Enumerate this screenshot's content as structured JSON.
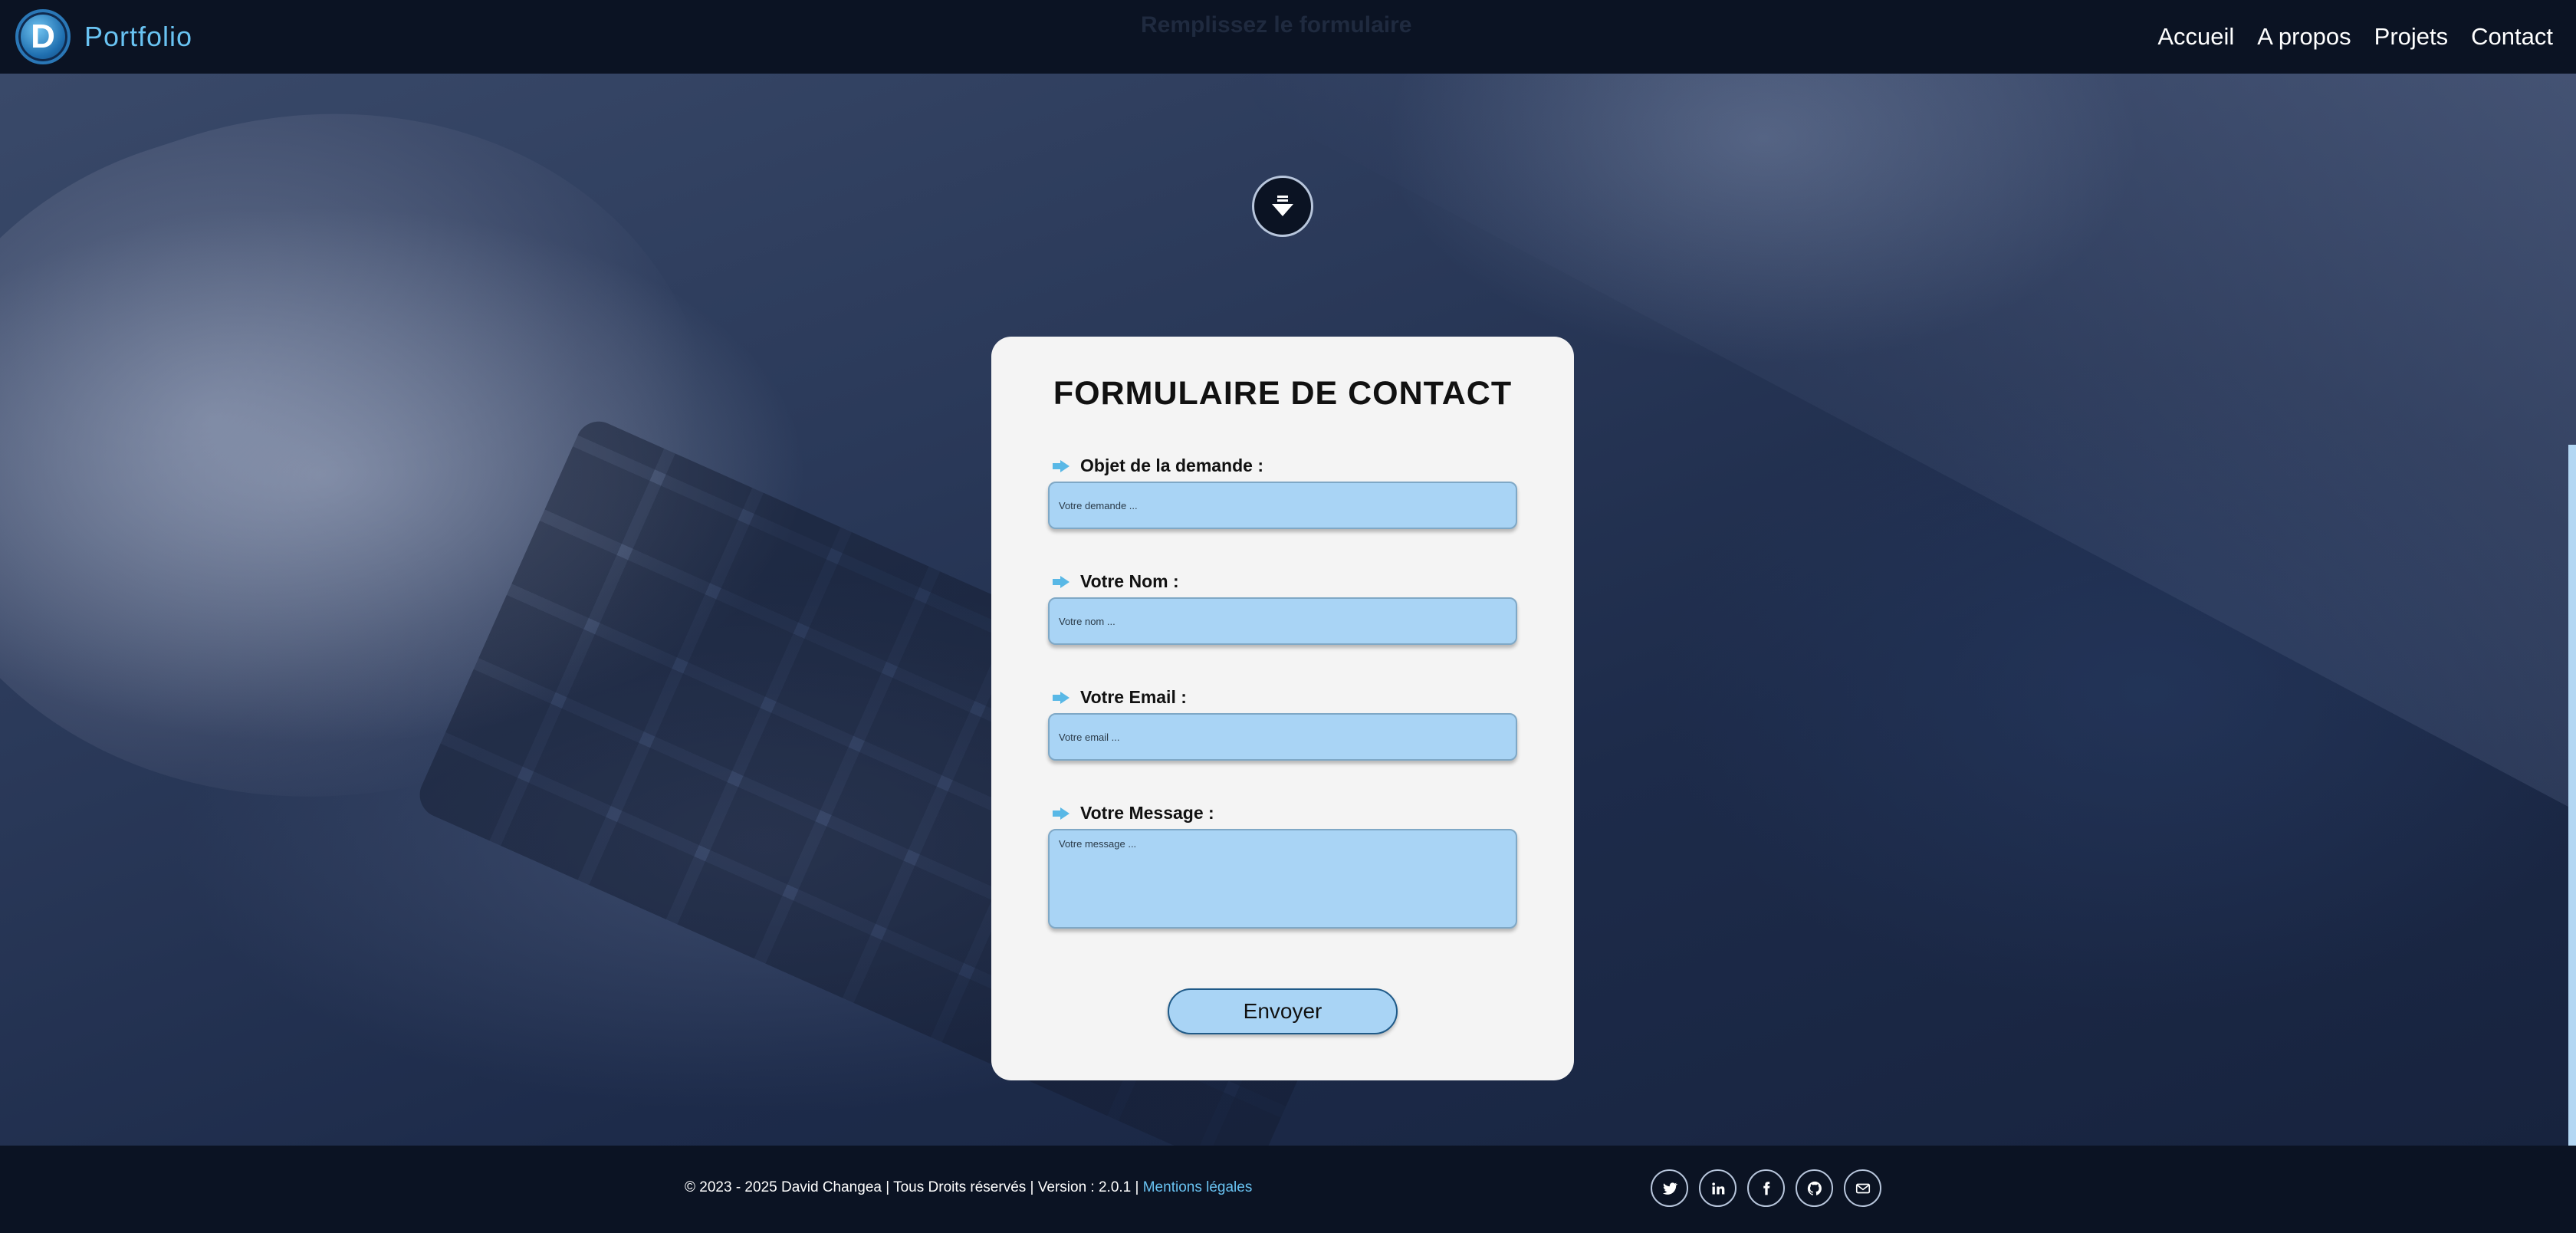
{
  "header": {
    "brand": "Portfolio",
    "ghost_title": "Remplissez le formulaire",
    "nav": [
      {
        "label": "Accueil"
      },
      {
        "label": "A propos"
      },
      {
        "label": "Projets"
      },
      {
        "label": "Contact"
      }
    ]
  },
  "form": {
    "title": "FORMULAIRE DE CONTACT",
    "fields": [
      {
        "label": "Objet de la demande :",
        "placeholder": "Votre demande ..."
      },
      {
        "label": "Votre Nom :",
        "placeholder": "Votre nom ..."
      },
      {
        "label": "Votre Email :",
        "placeholder": "Votre email ..."
      },
      {
        "label": "Votre Message :",
        "placeholder": "Votre message ..."
      }
    ],
    "submit_label": "Envoyer"
  },
  "footer": {
    "copyright": "© 2023 - 2025 David Changea | Tous Droits réservés | Version : 2.0.1 |",
    "legal_link": "Mentions légales",
    "socials": [
      "twitter-icon",
      "linkedin-icon",
      "facebook-icon",
      "github-icon",
      "mail-icon"
    ]
  },
  "colors": {
    "accent": "#69c3f2",
    "input_bg": "#a9d4f5",
    "header_bg": "#0b1323",
    "card_bg": "#f4f4f4"
  }
}
